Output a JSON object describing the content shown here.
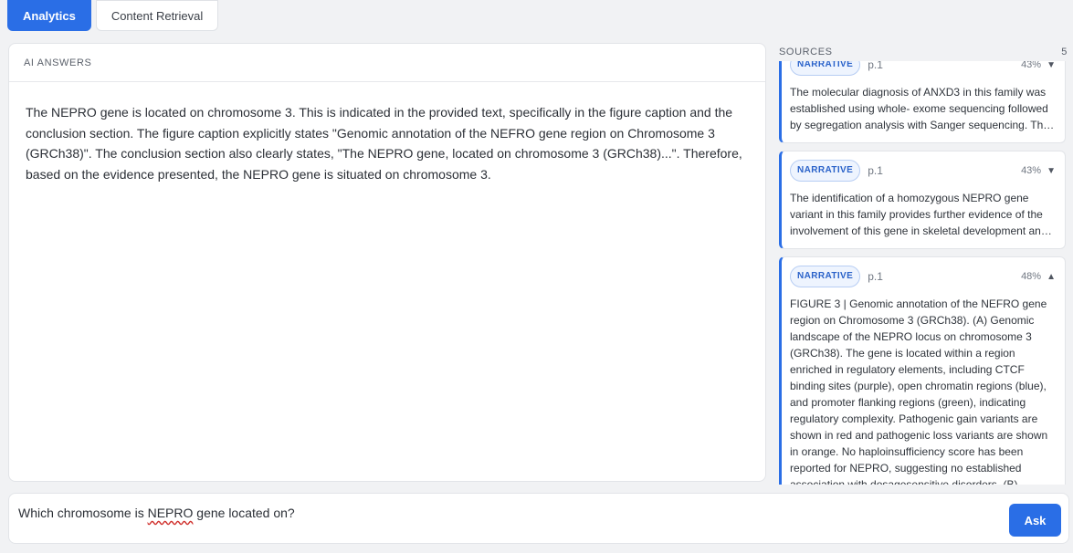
{
  "tabs": [
    {
      "label": "Analytics",
      "active": true
    },
    {
      "label": "Content Retrieval",
      "active": false
    }
  ],
  "answers": {
    "header": "AI ANSWERS",
    "text": "The NEPRO gene is located on chromosome 3. This is indicated in the provided text, specifically in the figure caption and the conclusion section. The figure caption explicitly states \"Genomic annotation of the NEFRO gene region on Chromosome 3 (GRCh38)\". The conclusion section also clearly states, \"The NEPRO gene, located on chromosome 3 (GRCh38)...\". Therefore, based on the evidence presented, the NEPRO gene is situated on chromosome 3."
  },
  "sources": {
    "header": "SOURCES",
    "count": "5",
    "items": [
      {
        "tag": "NARRATIVE",
        "page": "p.1",
        "score": "43%",
        "caret": "▼",
        "text": "The molecular diagnosis of ANXD3 in this family was established using whole- exome sequencing followed by segregation analysis with Sanger sequencing. This approach identified the variant in all affected members."
      },
      {
        "tag": "NARRATIVE",
        "page": "p.1",
        "score": "43%",
        "caret": "▼",
        "text": "The identification of a homozygous NEPRO gene variant in this family provides further evidence of the involvement of this gene in skeletal development and growth regulation."
      },
      {
        "tag": "NARRATIVE",
        "page": "p.1",
        "score": "48%",
        "caret": "▲",
        "text": "FIGURE 3 | Genomic annotation of the NEFRO gene region on Chromosome 3 (GRCh38). (A) Genomic landscape of the NEPRO locus on chromosome 3 (GRCh38). The gene is located within a region enriched in regulatory elements, including CTCF binding sites (purple), open chromatin regions (blue), and promoter flanking regions (green), indicating regulatory complexity. Pathogenic gain variants are shown in red and pathogenic loss variants are shown in orange. No haploinsufficiency score has been reported for NEPRO, suggesting no established association with dosagesensitive disorders. (B)"
      }
    ]
  },
  "ask": {
    "value_before": "Which chromosome is ",
    "value_flagged": "NEPRO",
    "value_after": " gene located on?",
    "button_label": "Ask"
  }
}
